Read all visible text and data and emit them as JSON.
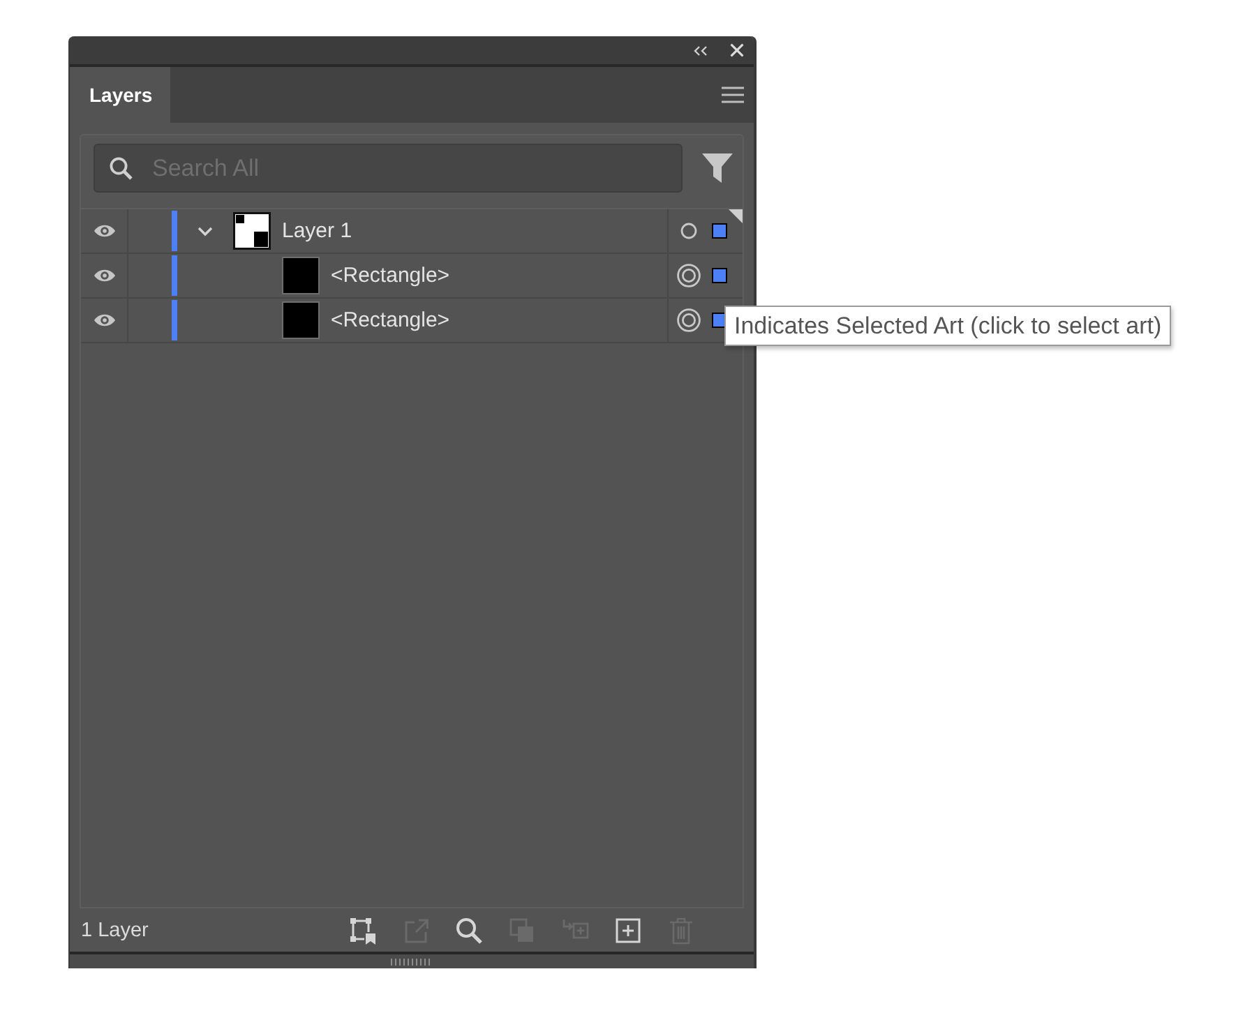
{
  "panel": {
    "tabs": [
      {
        "label": "Layers",
        "selected": true
      }
    ],
    "search": {
      "placeholder": "Search All"
    },
    "layers": [
      {
        "name": "Layer 1",
        "visible": true,
        "expanded": true,
        "current": true,
        "targeted": false,
        "selected": true,
        "color": "#4d80f5",
        "children": [
          {
            "name": "<Rectangle>",
            "visible": true,
            "targeted": true,
            "selected": true,
            "color": "#4d80f5"
          },
          {
            "name": "<Rectangle>",
            "visible": true,
            "targeted": true,
            "selected": true,
            "color": "#4d80f5"
          }
        ]
      }
    ],
    "status": "1 Layer",
    "toolbar": [
      {
        "kind": "artboard",
        "disabled": false
      },
      {
        "kind": "export",
        "disabled": true
      },
      {
        "kind": "locate",
        "disabled": false
      },
      {
        "kind": "clip",
        "disabled": true
      },
      {
        "kind": "sublayer",
        "disabled": true
      },
      {
        "kind": "newlayer",
        "disabled": false
      },
      {
        "kind": "trash",
        "disabled": true
      }
    ]
  },
  "tooltip": {
    "text": "Indicates Selected Art (click to select art)"
  }
}
